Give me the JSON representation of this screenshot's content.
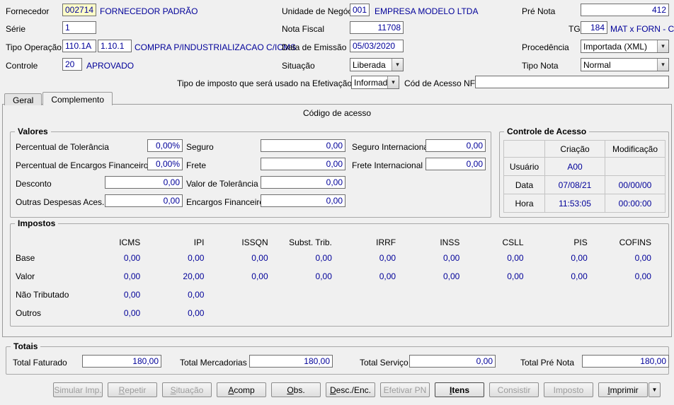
{
  "colors": {
    "window_bg": "#f0f0f0",
    "value_navy": "#000099",
    "supplier_field_yellow": "#ffffc8"
  },
  "icons": {
    "combo_arrow": "▾",
    "print_dropdown_arrow": "▼"
  },
  "header": {
    "fornecedor_label": "Fornecedor",
    "fornecedor_value": "002714",
    "fornecedor_desc": "FORNECEDOR PADRÃO",
    "unidade_label": "Unidade de Negócio",
    "unidade_value": "001",
    "unidade_desc": "EMPRESA MODELO LTDA",
    "pre_nota_label": "Pré Nota",
    "pre_nota_value": "412",
    "serie_label": "Série",
    "serie_value": "1",
    "nota_fiscal_label": "Nota Fiscal",
    "nota_fiscal_value": "11708",
    "tg_label": "TG",
    "tg_value": "184",
    "tg_desc": "MAT x FORN - CR",
    "tipo_operacao_label": "Tipo Operação",
    "tipo_operacao_value1": "110.1A",
    "tipo_operacao_value2": "1.10.1",
    "tipo_operacao_desc": "COMPRA P/INDUSTRIALIZACAO C/ICMS",
    "data_emissao_label": "Data de Emissão",
    "data_emissao_value": "05/03/2020",
    "procedencia_label": "Procedência",
    "procedencia_value": "Importada (XML)",
    "controle_label": "Controle",
    "controle_value": "20",
    "controle_desc": "APROVADO",
    "situacao_label": "Situação",
    "situacao_value": "Liberada",
    "tipo_nota_label": "Tipo Nota",
    "tipo_nota_value": "Normal",
    "tipo_imposto_label": "Tipo de imposto que será usado na Efetivação",
    "tipo_imposto_value": "Informado",
    "cod_acesso_label": "Cód de Acesso NFe",
    "cod_acesso_value": ""
  },
  "tabs": {
    "geral": "Geral",
    "complemento": "Complemento",
    "active": "Complemento"
  },
  "tab_page": {
    "codigo_acesso_caption": "Código de acesso"
  },
  "valores": {
    "title": "Valores",
    "perc_tolerancia_label": "Percentual de Tolerância",
    "perc_tolerancia_value": "0,00%",
    "perc_encargos_label": "Percentual de Encargos Financeiros",
    "perc_encargos_value": "0,00%",
    "desconto_label": "Desconto",
    "desconto_value": "0,00",
    "outras_despesas_label": "Outras Despesas Aces.",
    "outras_despesas_value": "0,00",
    "seguro_label": "Seguro",
    "seguro_value": "0,00",
    "frete_label": "Frete",
    "frete_value": "0,00",
    "valor_tolerancia_label": "Valor de Tolerância",
    "valor_tolerancia_value": "0,00",
    "encargos_label": "Encargos Financeiros",
    "encargos_value": "0,00",
    "seguro_int_label": "Seguro Internacional",
    "seguro_int_value": "0,00",
    "frete_int_label": "Frete Internacional",
    "frete_int_value": "0,00"
  },
  "controle_acesso": {
    "title": "Controle de Acesso",
    "col_criacao": "Criação",
    "col_modificacao": "Modificação",
    "rows": [
      {
        "label": "Usuário",
        "criacao": "A00",
        "modificacao": ""
      },
      {
        "label": "Data",
        "criacao": "07/08/21",
        "modificacao": "00/00/00"
      },
      {
        "label": "Hora",
        "criacao": "11:53:05",
        "modificacao": "00:00:00"
      }
    ]
  },
  "impostos": {
    "title": "Impostos",
    "columns": [
      "ICMS",
      "IPI",
      "ISSQN",
      "Subst. Trib.",
      "IRRF",
      "INSS",
      "CSLL",
      "PIS",
      "COFINS"
    ],
    "rows": [
      {
        "label": "Base",
        "values": [
          "0,00",
          "0,00",
          "0,00",
          "0,00",
          "0,00",
          "0,00",
          "0,00",
          "0,00",
          "0,00"
        ]
      },
      {
        "label": "Valor",
        "values": [
          "0,00",
          "20,00",
          "0,00",
          "0,00",
          "0,00",
          "0,00",
          "0,00",
          "0,00",
          "0,00"
        ]
      },
      {
        "label": "Não Tributado",
        "values": [
          "0,00",
          "0,00",
          "",
          "",
          "",
          "",
          "",
          "",
          ""
        ]
      },
      {
        "label": "Outros",
        "values": [
          "0,00",
          "0,00",
          "",
          "",
          "",
          "",
          "",
          "",
          ""
        ]
      }
    ]
  },
  "totais": {
    "title": "Totais",
    "faturado_label": "Total Faturado",
    "faturado_value": "180,00",
    "mercadorias_label": "Total Mercadorias",
    "mercadorias_value": "180,00",
    "servico_label": "Total Serviço",
    "servico_value": "0,00",
    "pre_nota_label": "Total Pré Nota",
    "pre_nota_value": "180,00"
  },
  "buttons": [
    {
      "label": "Simular Imp.",
      "enabled": false,
      "underline_first": false,
      "default": false
    },
    {
      "label": "Repetir",
      "enabled": false,
      "underline_first": true,
      "default": false
    },
    {
      "label": "Situação",
      "enabled": false,
      "underline_first": true,
      "default": false
    },
    {
      "label": "Acomp",
      "enabled": true,
      "underline_first": true,
      "default": false
    },
    {
      "label": "Obs.",
      "enabled": true,
      "underline_first": true,
      "default": false
    },
    {
      "label": "Desc./Enc.",
      "enabled": true,
      "underline_first": true,
      "default": false
    },
    {
      "label": "Efetivar PN",
      "enabled": false,
      "underline_first": false,
      "default": false
    },
    {
      "label": "Itens",
      "enabled": true,
      "underline_first": true,
      "default": true
    },
    {
      "label": "Consistir",
      "enabled": false,
      "underline_first": false,
      "default": false
    },
    {
      "label": "Imposto",
      "enabled": false,
      "underline_first": false,
      "default": false
    },
    {
      "label": "Imprimir",
      "enabled": true,
      "underline_first": true,
      "default": false
    }
  ]
}
